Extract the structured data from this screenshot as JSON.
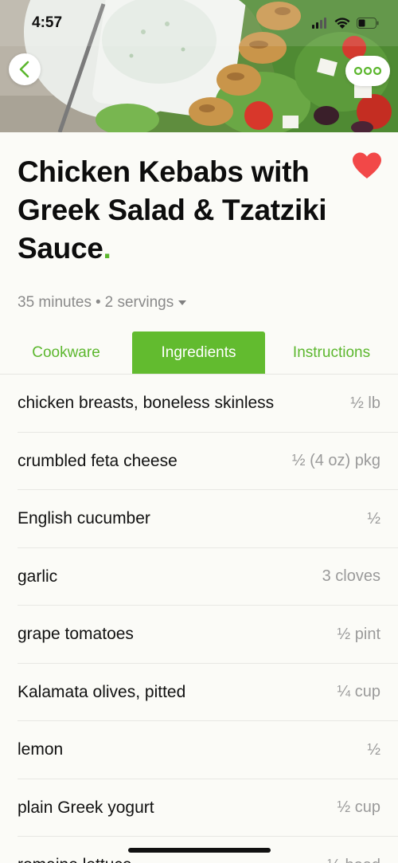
{
  "status": {
    "time": "4:57"
  },
  "recipe": {
    "title": "Chicken Kebabs with Greek Salad & Tzatziki Sauce",
    "title_dot": ".",
    "duration": "35 minutes",
    "separator": "•",
    "servings": "2 servings",
    "favorite": true
  },
  "tabs": [
    {
      "label": "Cookware",
      "active": false
    },
    {
      "label": "Ingredients",
      "active": true
    },
    {
      "label": "Instructions",
      "active": false
    }
  ],
  "ingredients": [
    {
      "name": "chicken breasts, boneless skinless",
      "qty": "½ lb"
    },
    {
      "name": "crumbled feta cheese",
      "qty": "½ (4 oz) pkg"
    },
    {
      "name": "English cucumber",
      "qty": "½"
    },
    {
      "name": "garlic",
      "qty": "3 cloves"
    },
    {
      "name": "grape tomatoes",
      "qty": "½ pint"
    },
    {
      "name": "Kalamata olives, pitted",
      "qty": "¼ cup"
    },
    {
      "name": "lemon",
      "qty": "½"
    },
    {
      "name": "plain Greek yogurt",
      "qty": "½ cup"
    },
    {
      "name": "romaine lettuce",
      "qty": "½ head"
    }
  ],
  "colors": {
    "accent": "#62bb2f",
    "heart": "#f24848"
  },
  "icons": {
    "back": "chevron-left-icon",
    "more": "more-icon",
    "favorite": "heart-icon",
    "servings_caret": "caret-down-icon"
  }
}
